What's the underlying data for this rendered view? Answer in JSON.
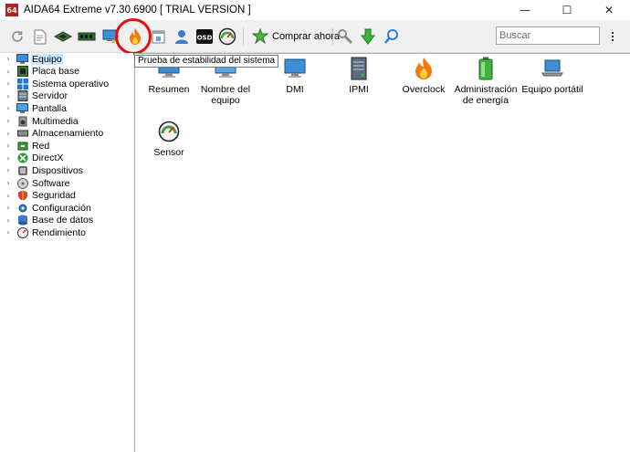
{
  "window": {
    "icon_text": "64",
    "title": "AIDA64 Extreme v7.30.6900  [ TRIAL VERSION ]",
    "minimize_glyph": "—",
    "maximize_glyph": "☐",
    "close_glyph": "✕"
  },
  "toolbar": {
    "buy_label": "Comprar ahora",
    "search_placeholder": "Buscar",
    "tooltip": "Prueba de estabilidad del sistema",
    "highlight_color": "#e01010"
  },
  "tree": {
    "items": [
      {
        "label": "Equipo",
        "icon": "computer-icon",
        "selected": true
      },
      {
        "label": "Placa base",
        "icon": "motherboard-icon"
      },
      {
        "label": "Sistema operativo",
        "icon": "windows-icon"
      },
      {
        "label": "Servidor",
        "icon": "server-icon"
      },
      {
        "label": "Pantalla",
        "icon": "monitor-icon"
      },
      {
        "label": "Multimedia",
        "icon": "multimedia-icon"
      },
      {
        "label": "Almacenamiento",
        "icon": "storage-icon"
      },
      {
        "label": "Red",
        "icon": "network-icon"
      },
      {
        "label": "DirectX",
        "icon": "directx-icon"
      },
      {
        "label": "Dispositivos",
        "icon": "devices-icon"
      },
      {
        "label": "Software",
        "icon": "software-icon"
      },
      {
        "label": "Seguridad",
        "icon": "security-icon"
      },
      {
        "label": "Configuración",
        "icon": "config-icon"
      },
      {
        "label": "Base de datos",
        "icon": "database-icon"
      },
      {
        "label": "Rendimiento",
        "icon": "performance-icon"
      }
    ]
  },
  "content": {
    "items": [
      {
        "label": "Resumen",
        "icon": "summary-icon"
      },
      {
        "label": "Nombre del equipo",
        "icon": "computer-name-icon"
      },
      {
        "label": "DMI",
        "icon": "dmi-icon"
      },
      {
        "label": "IPMI",
        "icon": "ipmi-icon"
      },
      {
        "label": "Overclock",
        "icon": "overclock-flame-icon"
      },
      {
        "label": "Administración de energía",
        "icon": "power-management-icon"
      },
      {
        "label": "Equipo portátil",
        "icon": "laptop-icon"
      },
      {
        "label": "Sensor",
        "icon": "sensor-gauge-icon"
      }
    ]
  }
}
